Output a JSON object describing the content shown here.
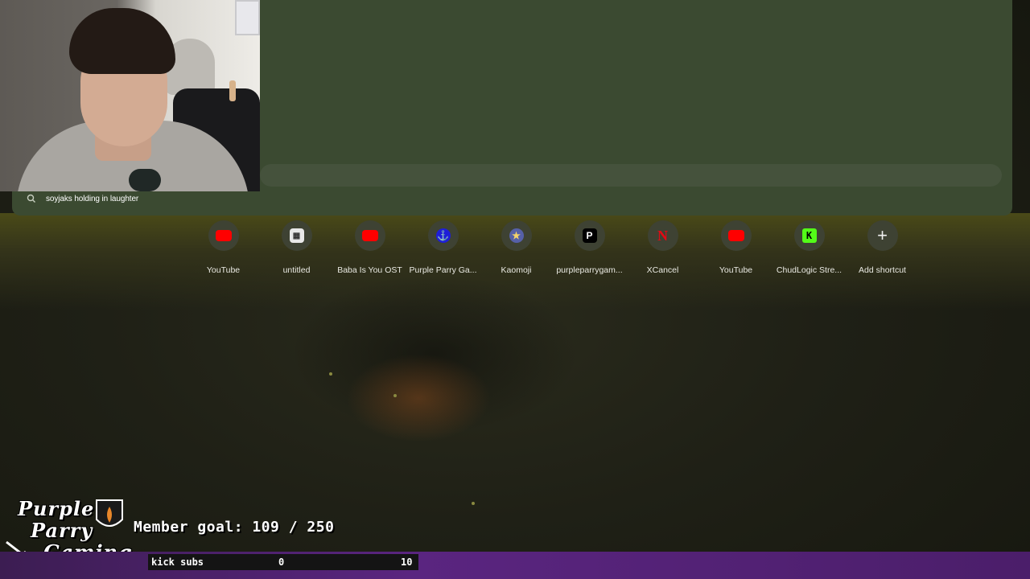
{
  "omnibox": {
    "suggestion": "soyjaks holding in laughter"
  },
  "shortcuts": [
    {
      "label": "YouTube",
      "icon": "youtube-icon"
    },
    {
      "label": "untitled",
      "icon": "document-icon"
    },
    {
      "label": "Baba Is You OST",
      "icon": "youtube-icon"
    },
    {
      "label": "Purple Parry Ga...",
      "icon": "purple-parry-icon"
    },
    {
      "label": "Kaomoji",
      "icon": "kaomoji-icon"
    },
    {
      "label": "purpleparrygam...",
      "icon": "patreon-icon"
    },
    {
      "label": "XCancel",
      "icon": "n-logo-icon"
    },
    {
      "label": "YouTube",
      "icon": "youtube-icon"
    },
    {
      "label": "ChudLogic Stre...",
      "icon": "kick-icon"
    },
    {
      "label": "Add shortcut",
      "icon": "plus-icon"
    }
  ],
  "overlay": {
    "logo_lines": [
      "Purple",
      "Parry",
      "Gaming"
    ],
    "member_goal": "Member goal: 109 / 250",
    "subs_label": "kick subs",
    "subs_current": "0",
    "subs_max": "10"
  },
  "colors": {
    "omnibox_panel": "#3b4a31",
    "youtube_red": "#ff0000",
    "kick_green": "#53fc18",
    "subs_bar_purple": "#5a2580"
  }
}
